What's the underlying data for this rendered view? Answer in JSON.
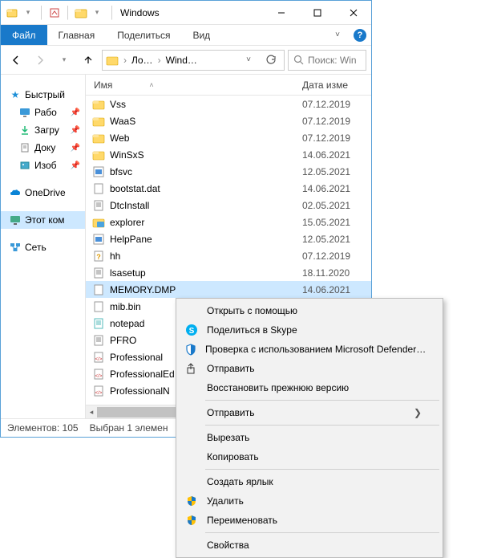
{
  "titlebar": {
    "title": "Windows"
  },
  "ribbon": {
    "file": "Файл",
    "tabs": [
      "Главная",
      "Поделиться",
      "Вид"
    ]
  },
  "nav": {
    "crumb1": "Ло…",
    "crumb2": "Wind…",
    "search_placeholder": "Поиск: Win"
  },
  "navpane": {
    "quick": "Быстрый",
    "items": [
      {
        "label": "Рабо"
      },
      {
        "label": "Загру"
      },
      {
        "label": "Доку"
      },
      {
        "label": "Изоб"
      }
    ],
    "onedrive": "OneDrive",
    "thispc": "Этот ком",
    "network": "Сеть"
  },
  "columns": {
    "name": "Имя",
    "date": "Дата изме"
  },
  "files": [
    {
      "name": "Vss",
      "date": "07.12.2019",
      "type": "folder"
    },
    {
      "name": "WaaS",
      "date": "07.12.2019",
      "type": "folder"
    },
    {
      "name": "Web",
      "date": "07.12.2019",
      "type": "folder"
    },
    {
      "name": "WinSxS",
      "date": "14.06.2021",
      "type": "folder"
    },
    {
      "name": "bfsvc",
      "date": "12.05.2021",
      "type": "exe"
    },
    {
      "name": "bootstat.dat",
      "date": "14.06.2021",
      "type": "file"
    },
    {
      "name": "DtcInstall",
      "date": "02.05.2021",
      "type": "txt"
    },
    {
      "name": "explorer",
      "date": "15.05.2021",
      "type": "explorer"
    },
    {
      "name": "HelpPane",
      "date": "12.05.2021",
      "type": "exe"
    },
    {
      "name": "hh",
      "date": "07.12.2019",
      "type": "help"
    },
    {
      "name": "lsasetup",
      "date": "18.11.2020",
      "type": "txt"
    },
    {
      "name": "MEMORY.DMP",
      "date": "14.06.2021",
      "type": "file",
      "selected": true
    },
    {
      "name": "mib.bin",
      "date": "",
      "type": "file"
    },
    {
      "name": "notepad",
      "date": "",
      "type": "notepad"
    },
    {
      "name": "PFRO",
      "date": "",
      "type": "txt"
    },
    {
      "name": "Professional",
      "date": "",
      "type": "xml"
    },
    {
      "name": "ProfessionalEd",
      "date": "",
      "type": "xml"
    },
    {
      "name": "ProfessionalN",
      "date": "",
      "type": "xml"
    }
  ],
  "status": {
    "count": "Элементов: 105",
    "selection": "Выбран 1 элемен"
  },
  "contextmenu": {
    "open_with": "Открыть с помощью",
    "skype": "Поделиться в Skype",
    "defender": "Проверка с использованием Microsoft Defender…",
    "share": "Отправить",
    "restore": "Восстановить прежнюю версию",
    "sendto": "Отправить",
    "cut": "Вырезать",
    "copy": "Копировать",
    "shortcut": "Создать ярлык",
    "delete": "Удалить",
    "rename": "Переименовать",
    "properties": "Свойства"
  }
}
